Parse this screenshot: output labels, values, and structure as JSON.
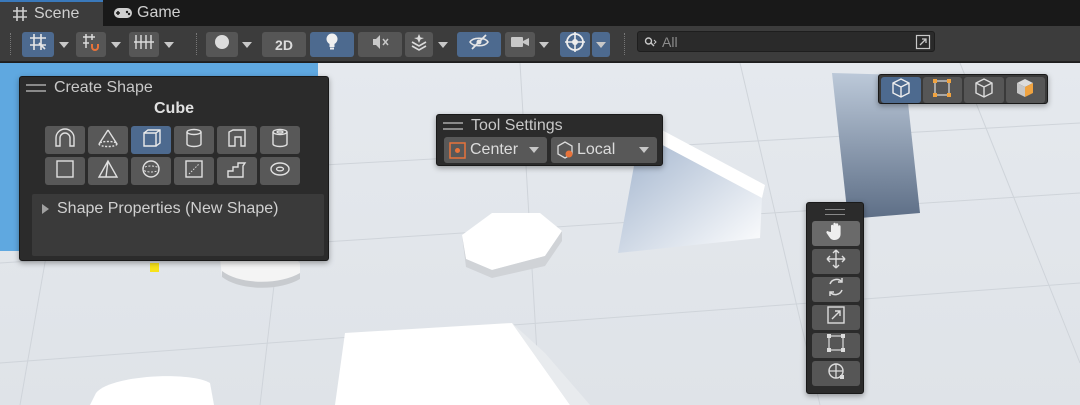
{
  "tabs": [
    {
      "label": "Scene",
      "icon": "grid-hash-icon",
      "active": true
    },
    {
      "label": "Game",
      "icon": "gamepad-icon",
      "active": false
    }
  ],
  "toolbar": {
    "view_2d_label": "2D",
    "search_placeholder": "All"
  },
  "create_shape": {
    "title": "Create Shape",
    "selected_shape": "Cube",
    "shape_properties_label": "Shape Properties (New Shape)",
    "shapes": [
      "arch",
      "cone",
      "cube",
      "cylinder",
      "door",
      "pipe",
      "plane",
      "prism",
      "sphere",
      "sprite",
      "stairs",
      "torus"
    ]
  },
  "tool_settings": {
    "title": "Tool Settings",
    "pivot_label": "Center",
    "space_label": "Local"
  },
  "colors": {
    "accent": "#4d6a8f",
    "panel": "#2b2b2b",
    "toolbar": "#3c3c3c",
    "scene_bg": "#e3e7ec"
  }
}
